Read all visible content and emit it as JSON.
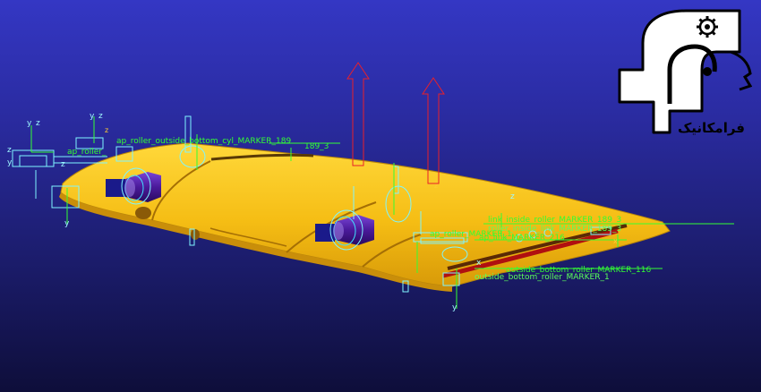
{
  "app": {
    "viewport_name": "3D model viewport",
    "background_top": "#3437c4",
    "background_bottom": "#0e0e3a"
  },
  "logo": {
    "text": "فرامکانیک",
    "icon": "gear-icon"
  },
  "colors": {
    "flap_surface": "#f5c21a",
    "flap_shadow": "#c58f0a",
    "actuator": "#4a1a9a",
    "marker_green": "#33ff33",
    "axis_cyan": "#9ff7ff",
    "force_red": "#e8202a",
    "roller_red": "#c01010"
  },
  "markers": {
    "m1": "ap_roller_outside_bottom_cyl_MARKER_189",
    "m2": "189_3",
    "m3": "ap_roller_",
    "m4": "link_inside_roller_MARKER_189_3",
    "m5": "roller_inside_link_MARKER_189_3",
    "m6": "ap_roller_MARKER_1",
    "m7": "outside_bottom_roller_MARKER_116",
    "m8": "outside_bottom_roller_MARKER_1",
    "m9": "ap_link_MARKER_216"
  },
  "axes": {
    "x": "x",
    "y": "y",
    "z": "z"
  }
}
